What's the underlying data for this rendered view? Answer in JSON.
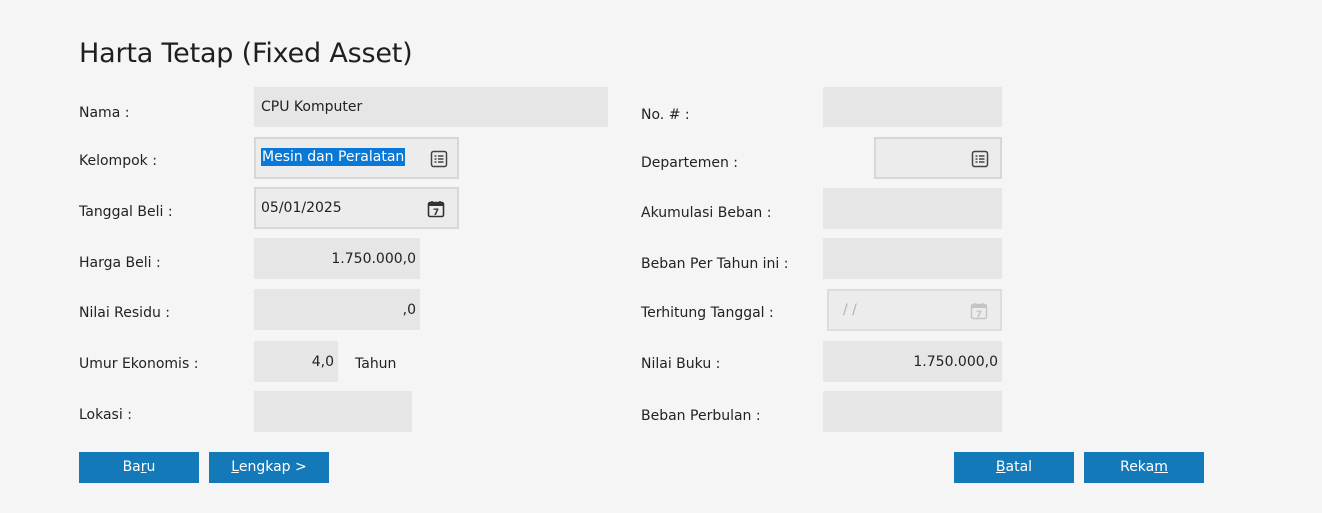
{
  "title": "Harta Tetap (Fixed Asset)",
  "left": {
    "nama": {
      "label": "Nama :",
      "value": "CPU Komputer"
    },
    "kelompok": {
      "label": "Kelompok :",
      "value": "Mesin dan Peralatan"
    },
    "tanggal_beli": {
      "label": "Tanggal Beli :",
      "value": "05/01/2025"
    },
    "harga_beli": {
      "label": "Harga Beli :",
      "value": "1.750.000,0"
    },
    "nilai_residu": {
      "label": "Nilai Residu :",
      "value": ",0"
    },
    "umur_ekonomis": {
      "label": "Umur Ekonomis :",
      "value": "4,0",
      "unit": "Tahun"
    },
    "lokasi": {
      "label": "Lokasi :",
      "value": ""
    }
  },
  "right": {
    "no": {
      "label": "No. # :",
      "value": ""
    },
    "departemen": {
      "label": "Departemen :",
      "value": ""
    },
    "akumulasi_beban": {
      "label": "Akumulasi Beban :",
      "value": ""
    },
    "beban_per_tahun": {
      "label": "Beban Per Tahun ini :",
      "value": ""
    },
    "terhitung_tanggal": {
      "label": "Terhitung Tanggal :",
      "value": "/ /"
    },
    "nilai_buku": {
      "label": "Nilai Buku :",
      "value": "1.750.000,0"
    },
    "beban_perbulan": {
      "label": "Beban Perbulan :",
      "value": ""
    }
  },
  "buttons": {
    "baru": {
      "pre": "Ba",
      "mnemonic": "r",
      "post": "u"
    },
    "lengkap": {
      "pre": "",
      "mnemonic": "L",
      "post": "engkap >"
    },
    "batal": {
      "pre": "",
      "mnemonic": "B",
      "post": "atal"
    },
    "rekam": {
      "pre": "Reka",
      "mnemonic": "m",
      "post": ""
    }
  },
  "colors": {
    "button": "#1479b8",
    "field": "#e6e6e6",
    "selection": "#0a78d7"
  },
  "icons": {
    "lookup": "list-lookup-icon",
    "calendar": "calendar-icon"
  }
}
